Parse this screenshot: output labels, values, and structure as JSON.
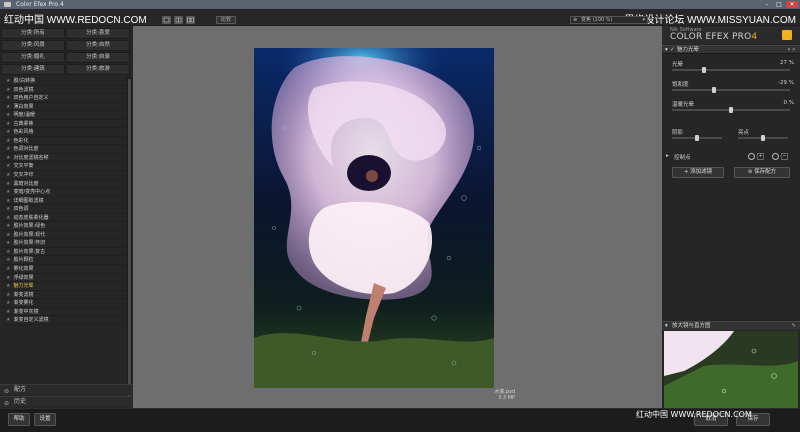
{
  "window": {
    "title": "Color Efex Pro 4",
    "minimize_glyph": "–",
    "maximize_glyph": "□",
    "close_glyph": "✕"
  },
  "watermark": {
    "left": "红动中国 WWW.REDOCN.COM",
    "right": "思缘设计论坛 WWW.MISSYUAN.COM",
    "bottom_right": "红动中国 WWW.REDOCN.COM"
  },
  "toolbar": {
    "view_single_icon": "single-view-icon",
    "view_split_icon": "split-view-icon",
    "view_side_icon": "side-by-side-icon",
    "compare_label": "比较",
    "zoom_label": "变焦 (100 %)"
  },
  "categories": [
    "分类:所有",
    "分类:喜爱",
    "分类:风景",
    "分类:自然",
    "分类:婚礼",
    "分类:自录",
    "分类:建筑",
    "分类:旅游"
  ],
  "filters": [
    "胶/白转换",
    "双色滤镜",
    "双色用户自定义",
    "薄白效果",
    "明度/温暖",
    "古典柔焦",
    "色彩风格",
    "色彩化",
    "色调对比度",
    "对比度滤镜名称",
    "交叉平衡",
    "交叉冲印",
    "黑暗对比度",
    "变暗/变亮中心点",
    "详细图取滤镜",
    "双色调",
    "动态皮肤柔化器",
    "胶片效果:绿色",
    "胶片效果:现代",
    "胶片效果:怀旧",
    "胶片效果:复古",
    "胶片颗粒",
    "雾化效果",
    "浮绿效果",
    "魅力光晕",
    "渐变滤镜",
    "渐变雾化",
    "渐变中灰镜",
    "渐变自定义滤镜"
  ],
  "active_filter_index": 24,
  "left_sections": {
    "recipes_label": "配方",
    "history_label": "历史"
  },
  "bottom": {
    "help_label": "帮助",
    "settings_label": "设置",
    "cancel_label": "取消",
    "save_label": "保存"
  },
  "image": {
    "file_name": "水底.psd",
    "file_size": "3.3 MP"
  },
  "right_panel": {
    "brand_sub": "Nik Software",
    "brand_title": "COLOR EFEX PRO",
    "brand_version": "4",
    "filter_name": "魅力光晕",
    "sliders": [
      {
        "label": "光晕",
        "value": "27 %",
        "fraction": 0.27
      },
      {
        "label": "饱和度",
        "value": "-29 %",
        "fraction": 0.355
      },
      {
        "label": "温暖光晕",
        "value": "0 %",
        "fraction": 0.5
      }
    ],
    "shadow_label": "阴影",
    "highlight_label": "亮点",
    "shadow_fraction": 0.5,
    "highlight_fraction": 0.5,
    "control_points_label": "控制点",
    "add_filter_label": "添加滤镜",
    "save_recipe_label": "保存配方",
    "loupe_label": "放大镜与直方图"
  }
}
